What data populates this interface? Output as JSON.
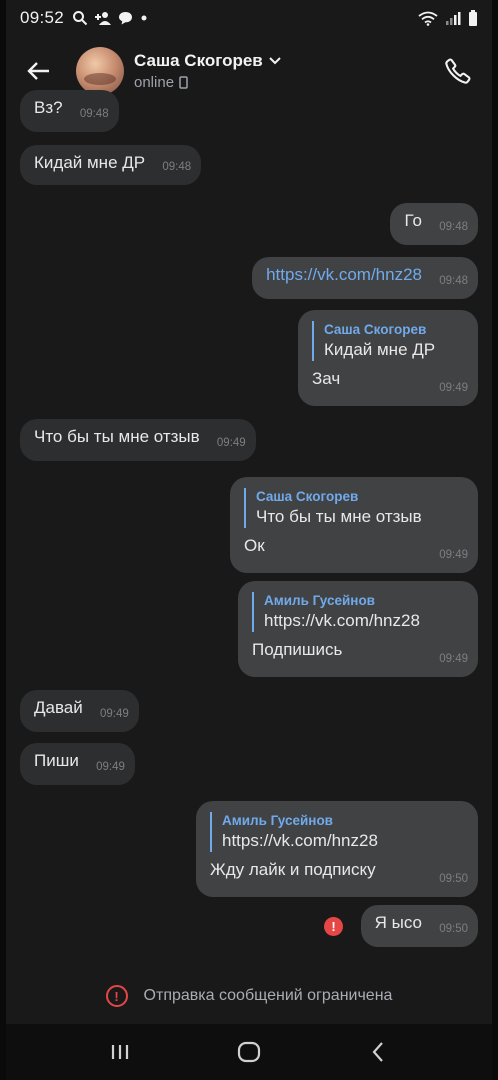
{
  "status_bar": {
    "time": "09:52",
    "icons_left": [
      "search-icon",
      "add-contact-icon",
      "chat-bubble-icon",
      "dot-icon"
    ],
    "icons_right": [
      "wifi-icon",
      "signal-icon",
      "battery-icon"
    ]
  },
  "header": {
    "peer_name": "Саша Скогорев",
    "peer_status": "online",
    "icons": [
      "back-arrow-icon",
      "chevron-down-icon",
      "phone-device-icon",
      "call-icon"
    ]
  },
  "messages": [
    {
      "dir": "in",
      "text": "Вз?",
      "time": "09:48"
    },
    {
      "dir": "in",
      "text": "Кидай мне ДР",
      "time": "09:48"
    },
    {
      "dir": "out",
      "text": "Го",
      "time": "09:48"
    },
    {
      "dir": "out",
      "text": "https://vk.com/hnz28",
      "time": "09:48",
      "is_link": true
    },
    {
      "dir": "out",
      "reply_name": "Саша Скогорев",
      "reply_text": "Кидай мне ДР",
      "text": "Зач",
      "time": "09:49"
    },
    {
      "dir": "in",
      "text": "Что бы ты мне отзыв",
      "time": "09:49"
    },
    {
      "dir": "out",
      "reply_name": "Саша Скогорев",
      "reply_text": "Что бы ты мне отзыв",
      "text": "Ок",
      "time": "09:49"
    },
    {
      "dir": "out",
      "reply_name": "Амиль Гусейнов",
      "reply_text": "https://vk.com/hnz28",
      "text": "Подпишись",
      "time": "09:49"
    },
    {
      "dir": "in",
      "text": "Давай",
      "time": "09:49"
    },
    {
      "dir": "in",
      "text": "Пиши",
      "time": "09:49"
    },
    {
      "dir": "out",
      "reply_name": "Амиль Гусейнов",
      "reply_text": "https://vk.com/hnz28",
      "text": "Жду лайк и подписку",
      "time": "09:50"
    },
    {
      "dir": "out",
      "text": "Я ысо",
      "time": "09:50",
      "failed": true
    }
  ],
  "restricted_notice": "Отправка сообщений ограничена",
  "nav_bar": {
    "icons": [
      "recent-apps-icon",
      "home-icon",
      "back-icon"
    ]
  },
  "colors": {
    "background": "#19191a",
    "incoming_bubble": "#2d2e30",
    "outgoing_bubble": "#414244",
    "accent": "#71aaeb",
    "error": "#e64646"
  }
}
